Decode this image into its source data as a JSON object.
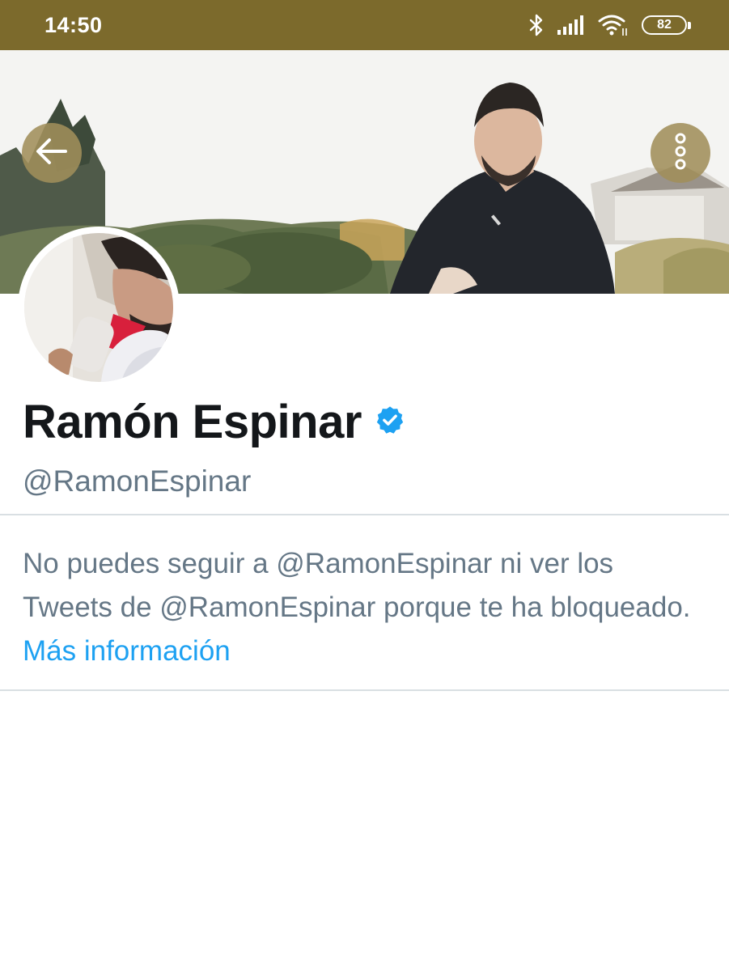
{
  "status_bar": {
    "time": "14:50",
    "battery": "82",
    "icons": [
      "bluetooth-icon",
      "signal-icon",
      "wifi-icon",
      "battery-icon"
    ],
    "color": "#7c6a2c"
  },
  "header": {
    "back_icon": "arrow-left-icon",
    "more_icon": "more-vertical-icon"
  },
  "profile": {
    "display_name": "Ramón Espinar",
    "verified_icon": "verified-badge-icon",
    "handle": "@RamonEspinar"
  },
  "blocked_notice": {
    "message": "No puedes seguir a @RamonEspinar ni ver los Tweets de @RamonEspinar porque te ha bloqueado.",
    "link_text": "Más información",
    "link_color": "#1da1f2"
  }
}
